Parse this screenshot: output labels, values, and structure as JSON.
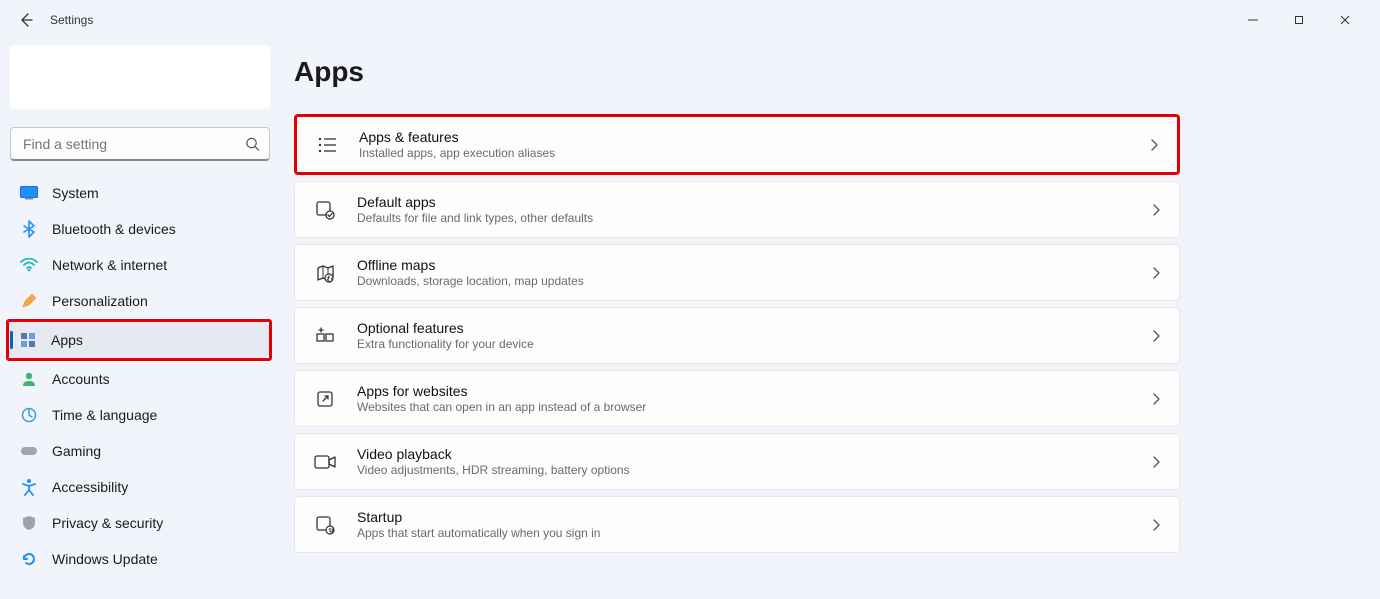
{
  "window": {
    "title": "Settings"
  },
  "search": {
    "placeholder": "Find a setting"
  },
  "sidebar": {
    "items": [
      {
        "label": "System"
      },
      {
        "label": "Bluetooth & devices"
      },
      {
        "label": "Network & internet"
      },
      {
        "label": "Personalization"
      },
      {
        "label": "Apps"
      },
      {
        "label": "Accounts"
      },
      {
        "label": "Time & language"
      },
      {
        "label": "Gaming"
      },
      {
        "label": "Accessibility"
      },
      {
        "label": "Privacy & security"
      },
      {
        "label": "Windows Update"
      }
    ]
  },
  "page": {
    "title": "Apps"
  },
  "cards": [
    {
      "title": "Apps & features",
      "desc": "Installed apps, app execution aliases"
    },
    {
      "title": "Default apps",
      "desc": "Defaults for file and link types, other defaults"
    },
    {
      "title": "Offline maps",
      "desc": "Downloads, storage location, map updates"
    },
    {
      "title": "Optional features",
      "desc": "Extra functionality for your device"
    },
    {
      "title": "Apps for websites",
      "desc": "Websites that can open in an app instead of a browser"
    },
    {
      "title": "Video playback",
      "desc": "Video adjustments, HDR streaming, battery options"
    },
    {
      "title": "Startup",
      "desc": "Apps that start automatically when you sign in"
    }
  ]
}
